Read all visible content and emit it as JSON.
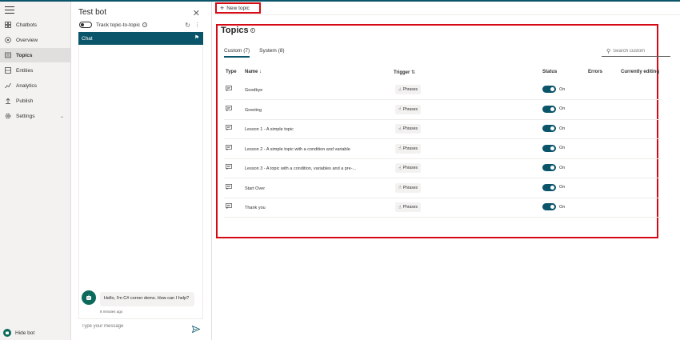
{
  "nav": {
    "items": [
      {
        "label": "Chatbots",
        "icon": "grid-icon"
      },
      {
        "label": "Overview",
        "icon": "overview-icon"
      },
      {
        "label": "Topics",
        "icon": "topics-icon",
        "active": true
      },
      {
        "label": "Entities",
        "icon": "entities-icon"
      },
      {
        "label": "Analytics",
        "icon": "analytics-icon"
      },
      {
        "label": "Publish",
        "icon": "publish-icon"
      },
      {
        "label": "Settings",
        "icon": "gear-icon"
      }
    ],
    "hide_bot": "Hide bot"
  },
  "testbot": {
    "title": "Test bot",
    "track_label": "Track topic-to-topic",
    "chat_tab": "Chat",
    "message": "Hello, I'm C# corner demo. How can I help?",
    "message_time": "8 minutes ago",
    "input_placeholder": "Type your message"
  },
  "toolbar": {
    "new_topic": "New topic"
  },
  "topics": {
    "title": "Topics",
    "tabs": [
      {
        "label": "Custom (7)",
        "active": true
      },
      {
        "label": "System (8)"
      }
    ],
    "search_placeholder": "Search custom",
    "columns": {
      "type": "Type",
      "name": "Name",
      "trigger": "Trigger",
      "status": "Status",
      "errors": "Errors",
      "current": "Currently editing"
    },
    "rows": [
      {
        "name": "Goodbye",
        "trigger": "Phrases",
        "status": "On"
      },
      {
        "name": "Greeting",
        "trigger": "Phrases",
        "status": "On"
      },
      {
        "name": "Lesson 1 - A simple topic",
        "trigger": "Phrases",
        "status": "On"
      },
      {
        "name": "Lesson 2 - A simple topic with a condition and variable",
        "trigger": "Phrases",
        "status": "On"
      },
      {
        "name": "Lesson 3 - A topic with a condition, variables and a pre-...",
        "trigger": "Phrases",
        "status": "On"
      },
      {
        "name": "Start Over",
        "trigger": "Phrases",
        "status": "On"
      },
      {
        "name": "Thank you",
        "trigger": "Phrases",
        "status": "On"
      }
    ]
  },
  "colors": {
    "accent": "#0b556a",
    "highlight_border": "#d50a14",
    "nav_bg": "#f3f2f1"
  }
}
